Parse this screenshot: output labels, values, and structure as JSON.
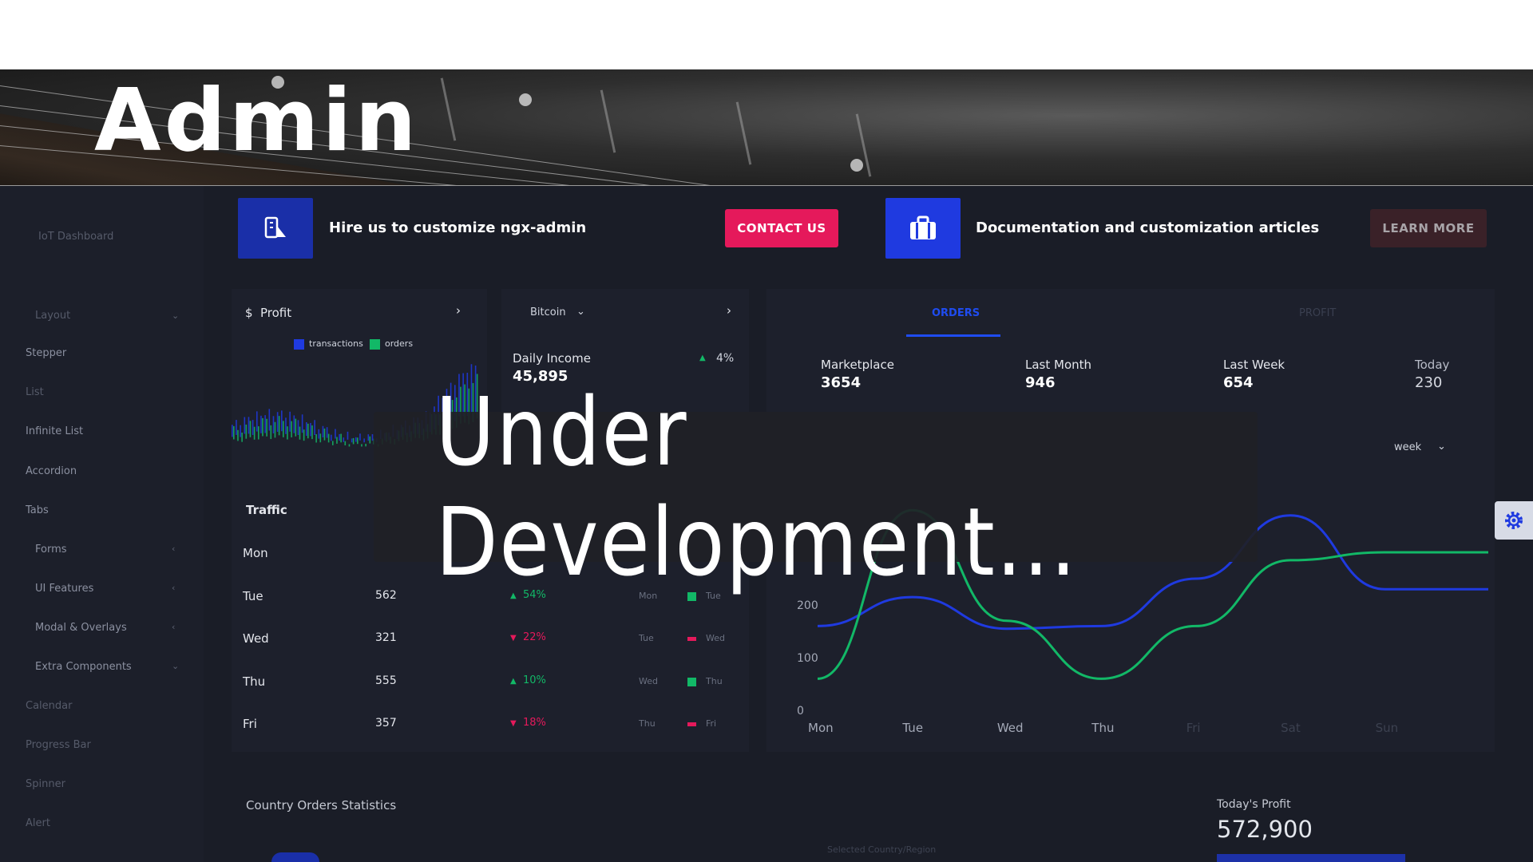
{
  "brand": {
    "title": "Admin"
  },
  "sidebar": {
    "items": [
      {
        "label": "IoT Dashboard"
      },
      {
        "label": "Layout"
      },
      {
        "label": "Stepper"
      },
      {
        "label": "List"
      },
      {
        "label": "Infinite List"
      },
      {
        "label": "Accordion"
      },
      {
        "label": "Tabs"
      },
      {
        "label": "Forms"
      },
      {
        "label": "UI Features"
      },
      {
        "label": "Modal & Overlays"
      },
      {
        "label": "Extra Components"
      },
      {
        "label": "Calendar"
      },
      {
        "label": "Progress Bar"
      },
      {
        "label": "Spinner"
      },
      {
        "label": "Alert"
      }
    ]
  },
  "cta": {
    "hire_text": "Hire us to customize ngx-admin",
    "contact_label": "CONTACT US",
    "docs_text": "Documentation and customization articles",
    "learn_label": "LEARN MORE",
    "colors": {
      "contact": "#e5195b",
      "hire_icon_bg": "#1a2fa8",
      "docs_icon_bg": "#1f3ae0",
      "learn": "#3a2128"
    }
  },
  "profit_card": {
    "currency": "$",
    "title": "Profit",
    "legend": [
      "transactions",
      "orders"
    ],
    "colors": {
      "transactions": "#1f3ae0",
      "orders": "#12b867"
    }
  },
  "income_card": {
    "select": "Bitcoin",
    "label": "Daily Income",
    "value": "45,895",
    "delta": "4%"
  },
  "orders_card": {
    "tabs": [
      "ORDERS",
      "PROFIT"
    ],
    "stats": [
      {
        "label": "Marketplace",
        "value": "3654"
      },
      {
        "label": "Last Month",
        "value": "946"
      },
      {
        "label": "Last Week",
        "value": "654"
      },
      {
        "label": "Today",
        "value": "230"
      }
    ],
    "period": "week"
  },
  "traffic": {
    "title": "Traffic",
    "rows": [
      {
        "day": "Mon",
        "value": "",
        "delta": "",
        "dir": "",
        "prev": "",
        "cur": ""
      },
      {
        "day": "Tue",
        "value": "562",
        "delta": "54%",
        "dir": "up",
        "prev": "Mon",
        "cur": "Tue"
      },
      {
        "day": "Wed",
        "value": "321",
        "delta": "22%",
        "dir": "down",
        "prev": "Tue",
        "cur": "Wed"
      },
      {
        "day": "Thu",
        "value": "555",
        "delta": "10%",
        "dir": "up",
        "prev": "Wed",
        "cur": "Thu"
      },
      {
        "day": "Fri",
        "value": "357",
        "delta": "18%",
        "dir": "down",
        "prev": "Thu",
        "cur": "Fri"
      }
    ],
    "colors": {
      "up": "#12b867",
      "down": "#e5195b"
    }
  },
  "chart_data": {
    "type": "line",
    "categories": [
      "Mon",
      "Tue",
      "Wed",
      "Thu",
      "Fri",
      "Sat",
      "Sun"
    ],
    "y_ticks": [
      "0",
      "100",
      "200"
    ],
    "ylim": [
      0,
      500
    ],
    "series": [
      {
        "values": [
          160,
          215,
          155,
          160,
          250,
          370,
          230
        ],
        "color": "#1f3ae0"
      },
      {
        "values": [
          60,
          380,
          170,
          60,
          160,
          285,
          300
        ],
        "color": "#12b867"
      }
    ],
    "grid": false,
    "legend": "none"
  },
  "bottom": {
    "country_title": "Country Orders Statistics",
    "selected_region": "Selected Country/Region",
    "profit_label": "Today's Profit",
    "profit_value": "572,900"
  },
  "overlay": {
    "text": "Under Development..."
  }
}
